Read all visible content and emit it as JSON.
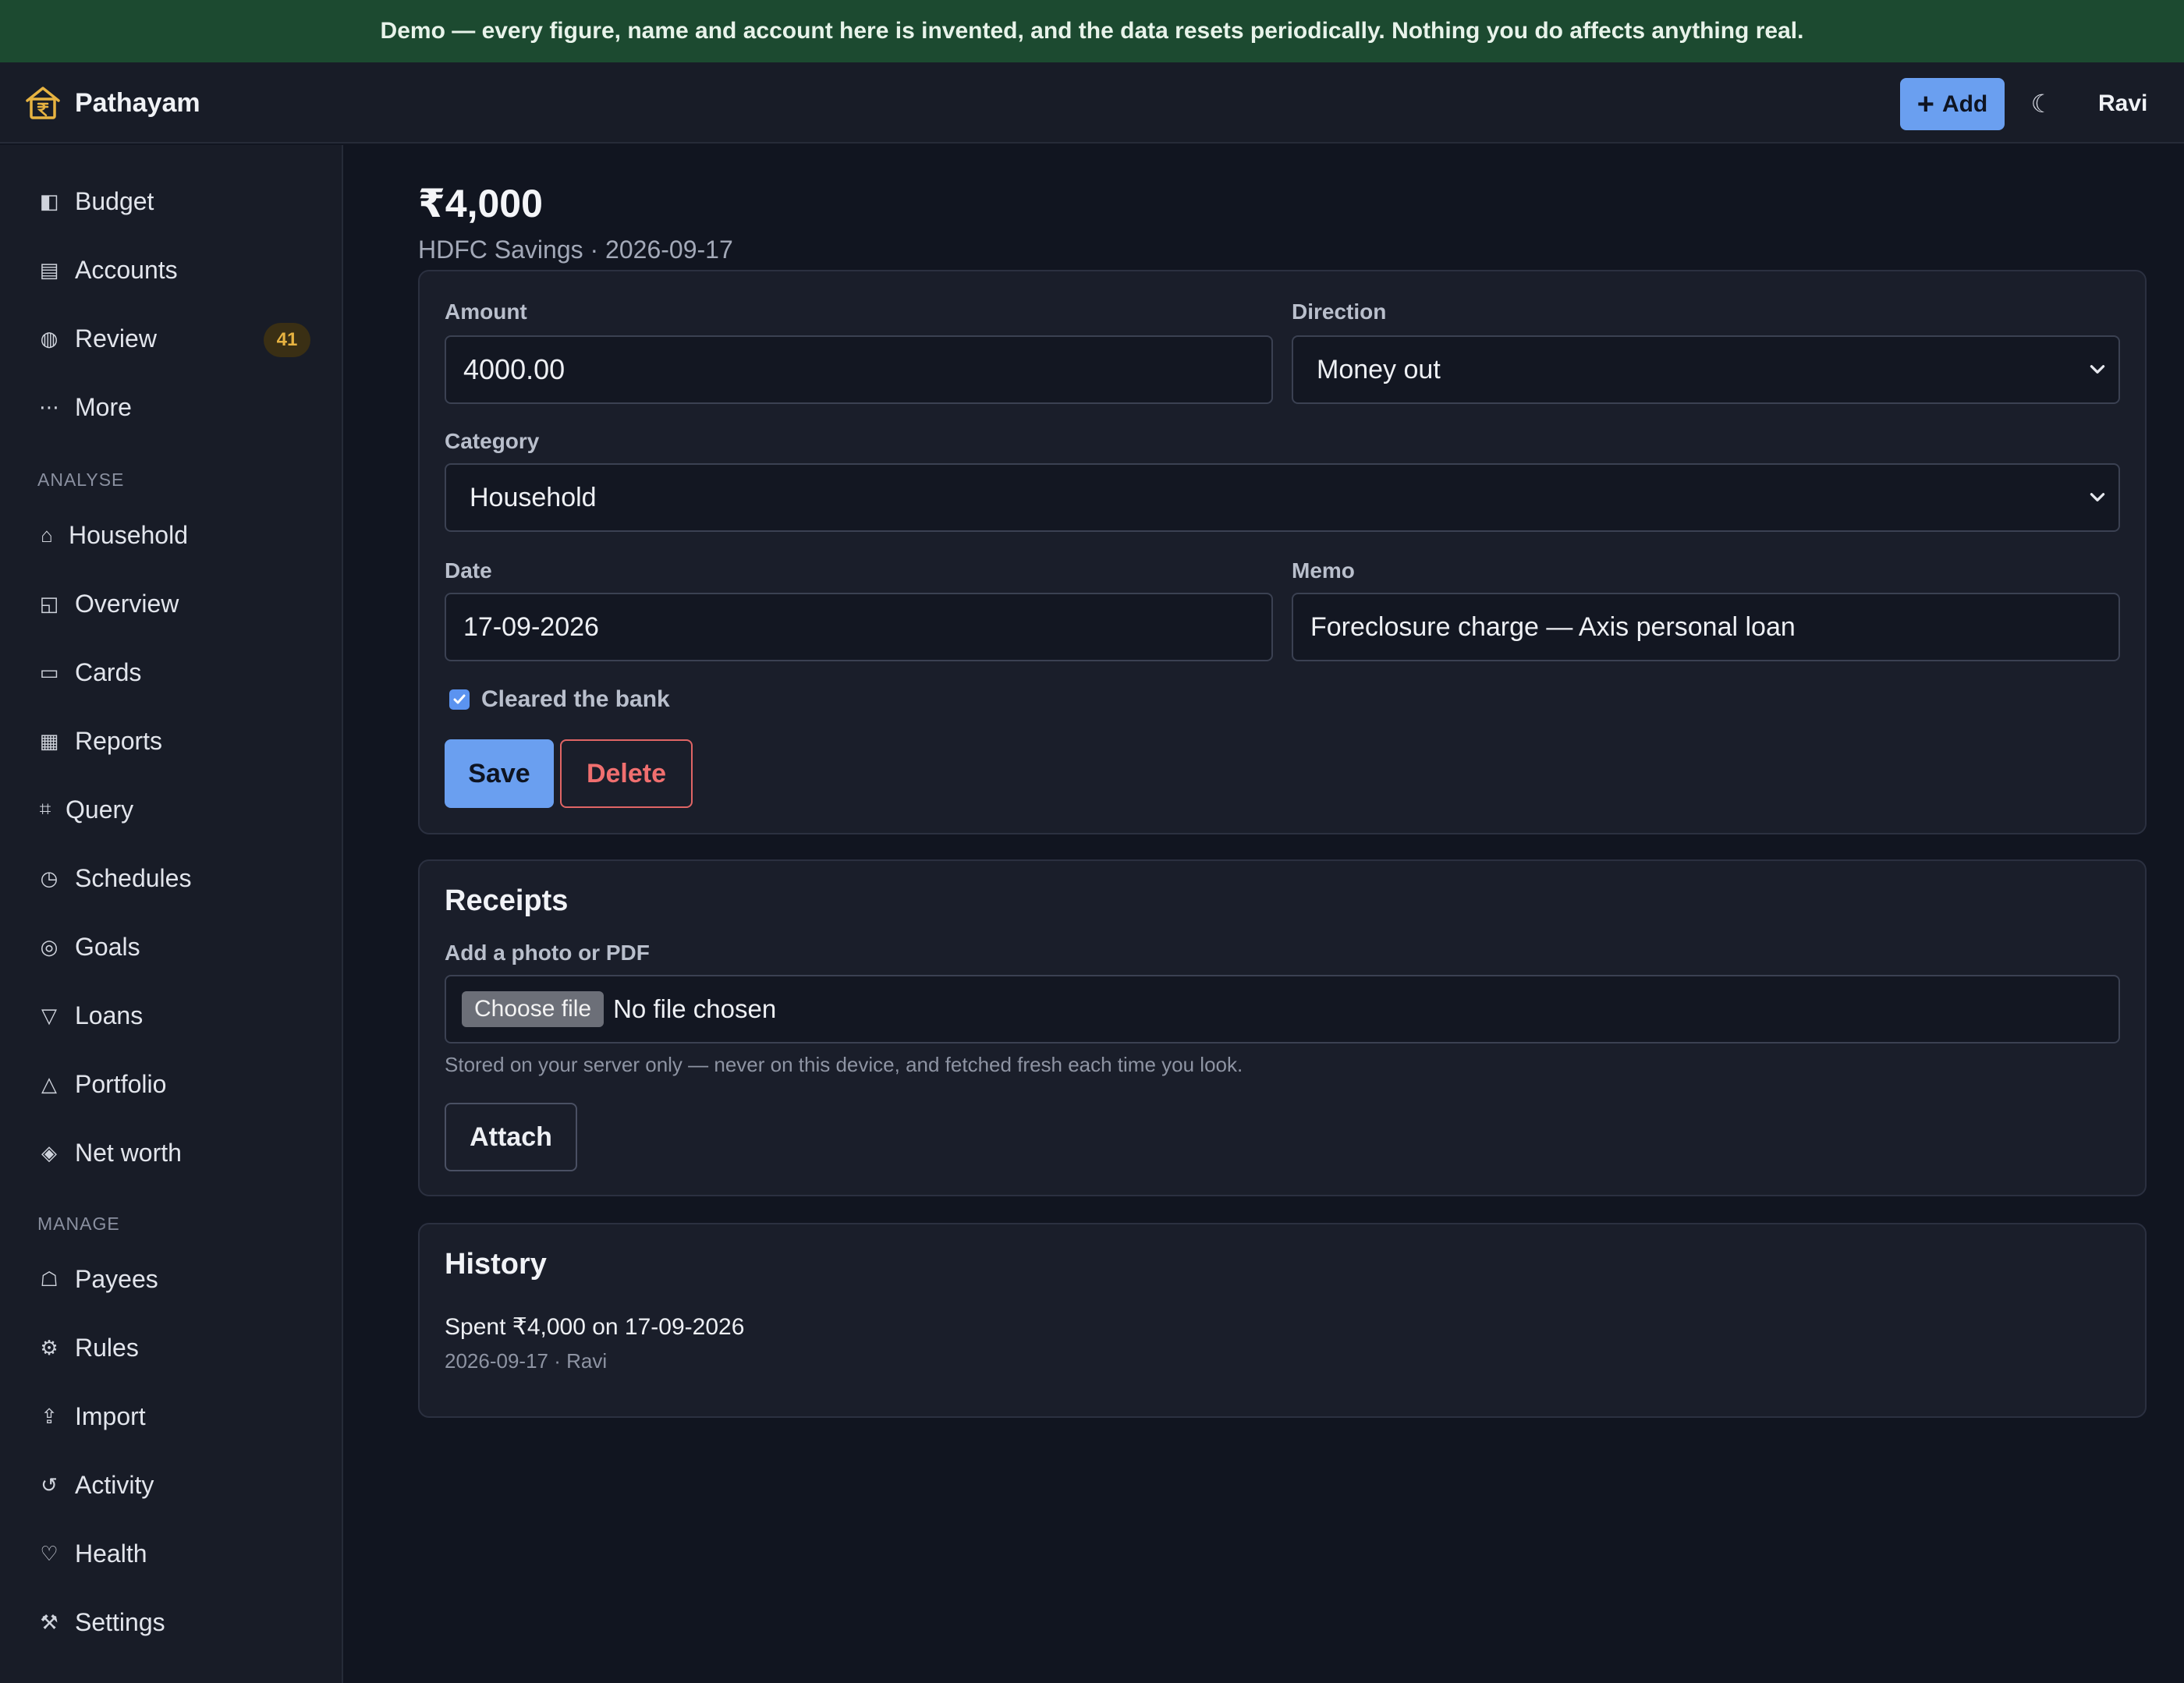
{
  "banner": {
    "text": "Demo — every figure, name and account here is invented, and the data resets periodically. Nothing you do affects anything real."
  },
  "header": {
    "app_name": "Pathayam",
    "logo_icon": "house-rupee-icon",
    "add_label": "Add",
    "theme_icon": "moon-icon",
    "theme_glyph": "☾",
    "user": "Ravi"
  },
  "sidebar": {
    "primary": [
      {
        "label": "Budget",
        "glyph": "◧",
        "icon": "budget-icon"
      },
      {
        "label": "Accounts",
        "glyph": "▤",
        "icon": "accounts-icon"
      },
      {
        "label": "Review",
        "glyph": "◍",
        "icon": "review-icon",
        "badge": "41"
      },
      {
        "label": "More",
        "glyph": "⋯",
        "icon": "more-icon"
      }
    ],
    "analyse_heading": "ANALYSE",
    "analyse": [
      {
        "label": "Household",
        "glyph": "⌂",
        "icon": "household-icon"
      },
      {
        "label": "Overview",
        "glyph": "◱",
        "icon": "overview-icon"
      },
      {
        "label": "Cards",
        "glyph": "▭",
        "icon": "cards-icon"
      },
      {
        "label": "Reports",
        "glyph": "▦",
        "icon": "reports-icon"
      },
      {
        "label": "Query",
        "glyph": "⌗",
        "icon": "query-icon"
      },
      {
        "label": "Schedules",
        "glyph": "◷",
        "icon": "schedules-icon"
      },
      {
        "label": "Goals",
        "glyph": "◎",
        "icon": "goals-icon"
      },
      {
        "label": "Loans",
        "glyph": "▽",
        "icon": "loans-icon"
      },
      {
        "label": "Portfolio",
        "glyph": "△",
        "icon": "portfolio-icon"
      },
      {
        "label": "Net worth",
        "glyph": "◈",
        "icon": "net-worth-icon"
      }
    ],
    "manage_heading": "MANAGE",
    "manage": [
      {
        "label": "Payees",
        "glyph": "☖",
        "icon": "payees-icon"
      },
      {
        "label": "Rules",
        "glyph": "⚙",
        "icon": "rules-icon"
      },
      {
        "label": "Import",
        "glyph": "⇪",
        "icon": "import-icon"
      },
      {
        "label": "Activity",
        "glyph": "↺",
        "icon": "activity-icon"
      },
      {
        "label": "Health",
        "glyph": "♡",
        "icon": "health-icon"
      },
      {
        "label": "Settings",
        "glyph": "⚒",
        "icon": "settings-icon"
      }
    ]
  },
  "transaction": {
    "amount_display": "₹4,000",
    "subtitle": "HDFC Savings · 2026-09-17",
    "form": {
      "amount_label": "Amount",
      "amount_value": "4000.00",
      "direction_label": "Direction",
      "direction_value": "Money out",
      "category_label": "Category",
      "category_value": "Household",
      "date_label": "Date",
      "date_value": "17-09-2026",
      "memo_label": "Memo",
      "memo_value": "Foreclosure charge — Axis personal loan",
      "cleared_label": "Cleared the bank",
      "cleared_checked": true,
      "save_label": "Save",
      "delete_label": "Delete"
    }
  },
  "receipts": {
    "title": "Receipts",
    "file_label": "Add a photo or PDF",
    "choose_button": "Choose file",
    "file_status": "No file chosen",
    "hint": "Stored on your server only — never on this device, and fetched fresh each time you look.",
    "attach_label": "Attach"
  },
  "history": {
    "title": "History",
    "entry": "Spent ₹4,000 on 17-09-2026",
    "meta": "2026-09-17 · Ravi"
  },
  "colors": {
    "accent": "#6a9ff0",
    "danger": "#e06565",
    "banner": "#1c4a30",
    "badge": "#e7b341"
  }
}
